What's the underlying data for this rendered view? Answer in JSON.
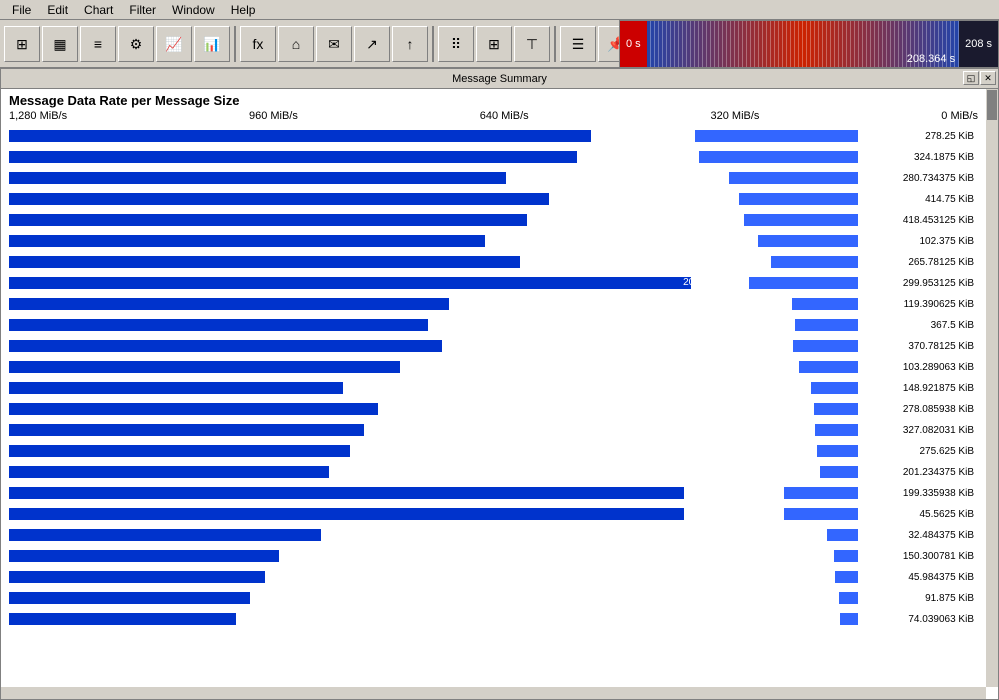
{
  "menubar": {
    "items": [
      "File",
      "Edit",
      "Chart",
      "Filter",
      "Window",
      "Help"
    ]
  },
  "timeline": {
    "start_label": "0 s",
    "end_label": "208 s",
    "time_marker": "208.364 s"
  },
  "window": {
    "title": "Message Summary",
    "chart_title": "Message Data Rate per Message Size"
  },
  "axis": {
    "labels": [
      "1,280 MiB/s",
      "960 MiB/s",
      "640 MiB/s",
      "320 MiB/s",
      "0 MiB/s"
    ]
  },
  "bars": [
    {
      "rate": "362.986 MiB/s",
      "size": "278.25 KiB",
      "outer_pct": 82,
      "inner_pct": 28
    },
    {
      "rate": "358.183 MiB/s",
      "size": "324.1875 KiB",
      "outer_pct": 80,
      "inner_pct": 28
    },
    {
      "rate": "338.63 MiB/s",
      "size": "280.734375 KiB",
      "outer_pct": 70,
      "inner_pct": 26
    },
    {
      "rate": "285.247 MiB/s",
      "size": "414.75 KiB",
      "outer_pct": 76,
      "inner_pct": 22
    },
    {
      "rate": "284.502 MiB/s",
      "size": "418.453125 KiB",
      "outer_pct": 73,
      "inner_pct": 22
    },
    {
      "rate": "270.838 MiB/s",
      "size": "102.375 KiB",
      "outer_pct": 67,
      "inner_pct": 21
    },
    {
      "rate": "218.484 MiB/s",
      "size": "265.78125 KiB",
      "outer_pct": 72,
      "inner_pct": 17
    },
    {
      "rate": "208.848 MiB/s",
      "size": "299.953125 KiB",
      "outer_pct": 96,
      "inner_pct": 16
    },
    {
      "rate": "196.794 MiB/s",
      "size": "119.390625 KiB",
      "outer_pct": 62,
      "inner_pct": 15
    },
    {
      "rate": "196.361 MiB/s",
      "size": "367.5 KiB",
      "outer_pct": 59,
      "inner_pct": 15
    },
    {
      "rate": "191.816 MiB/s",
      "size": "370.78125 KiB",
      "outer_pct": 61,
      "inner_pct": 15
    },
    {
      "rate": "186.587 MiB/s",
      "size": "103.289063 KiB",
      "outer_pct": 55,
      "inner_pct": 15
    },
    {
      "rate": "175.799 MiB/s",
      "size": "148.921875 KiB",
      "outer_pct": 47,
      "inner_pct": 14
    },
    {
      "rate": "158.466 MiB/s",
      "size": "278.085938 KiB",
      "outer_pct": 52,
      "inner_pct": 12
    },
    {
      "rate": "158.336 MiB/s",
      "size": "327.082031 KiB",
      "outer_pct": 50,
      "inner_pct": 12
    },
    {
      "rate": "153.703 MiB/s",
      "size": "275.625 KiB",
      "outer_pct": 48,
      "inner_pct": 12
    },
    {
      "rate": "153.229 MiB/s",
      "size": "201.234375 KiB",
      "outer_pct": 45,
      "inner_pct": 12
    },
    {
      "rate": "147.844 MiB/s",
      "size": "199.335938 KiB",
      "outer_pct": 95,
      "inner_pct": 11
    },
    {
      "rate": "135.651 MiB/s",
      "size": "45.5625 KiB",
      "outer_pct": 95,
      "inner_pct": 11
    },
    {
      "rate": "134.682 MiB/s",
      "size": "32.484375 KiB",
      "outer_pct": 44,
      "inner_pct": 10
    },
    {
      "rate": "121.162 MiB/s",
      "size": "150.300781 KiB",
      "outer_pct": 38,
      "inner_pct": 9
    },
    {
      "rate": "113.431 MiB/s",
      "size": "45.984375 KiB",
      "outer_pct": 36,
      "inner_pct": 9
    },
    {
      "rate": "109.123 MiB/s",
      "size": "91.875 KiB",
      "outer_pct": 34,
      "inner_pct": 8
    },
    {
      "rate": "104.773 MiB/s",
      "size": "74.039063 KiB",
      "outer_pct": 32,
      "inner_pct": 8
    }
  ]
}
